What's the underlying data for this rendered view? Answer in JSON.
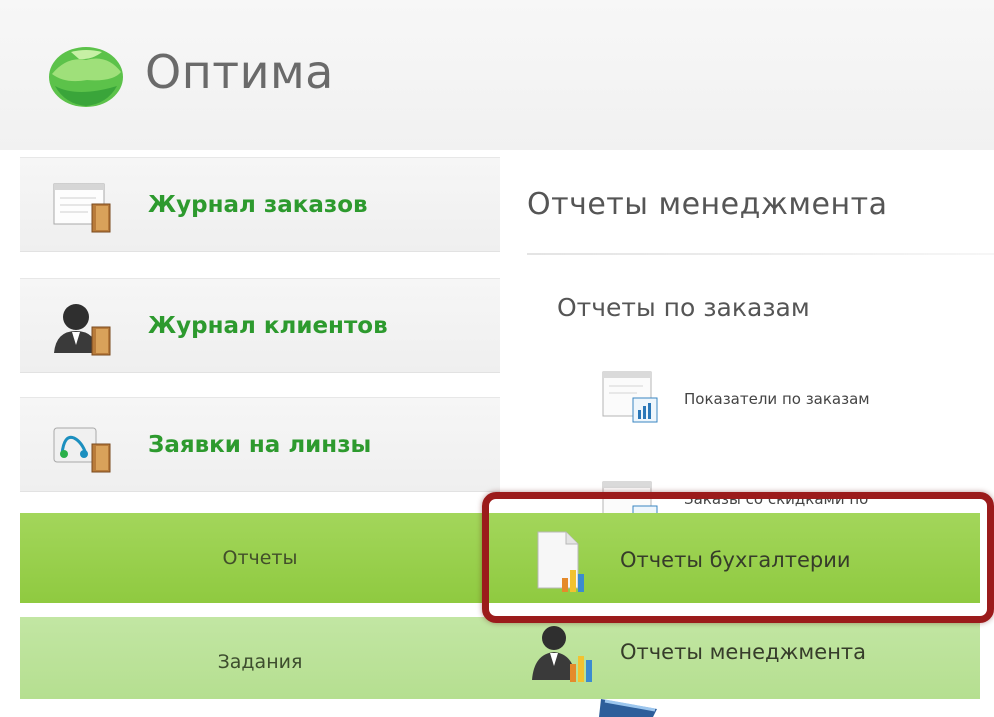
{
  "app": {
    "title": "Оптима"
  },
  "sidebar": {
    "items": [
      {
        "label": "Журнал заказов",
        "icon": "document-book-icon"
      },
      {
        "label": "Журнал клиентов",
        "icon": "user-book-icon"
      },
      {
        "label": "Заявки на линзы",
        "icon": "lens-book-icon"
      },
      {
        "label": "Отчеты",
        "icon": ""
      },
      {
        "label": "Задания",
        "icon": ""
      }
    ]
  },
  "content": {
    "title": "Отчеты менеджмента",
    "section_title": "Отчеты по заказам",
    "reports": [
      {
        "label": "Показатели по заказам",
        "icon": "report-chart-icon"
      },
      {
        "label": "Заказы со скидками по",
        "icon": "report-chart-icon"
      }
    ]
  },
  "submenu": {
    "items": [
      {
        "label": "Отчеты бухгалтерии",
        "icon": "document-chart-icon"
      },
      {
        "label": "Отчеты менеджмента",
        "icon": "manager-chart-icon"
      }
    ]
  },
  "colors": {
    "accent_green": "#8fca40",
    "light_green": "#b5df90",
    "link_green": "#2d9a2e",
    "highlight_red": "#9b1b1b"
  }
}
